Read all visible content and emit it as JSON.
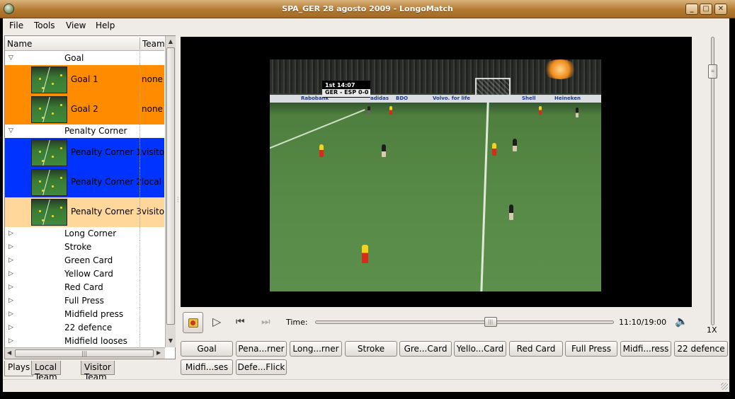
{
  "window": {
    "title": "SPA_GER 28 agosto 2009 - LongoMatch",
    "minimize": "_",
    "maximize": "□",
    "close": "✕"
  },
  "menu": [
    "File",
    "Tools",
    "View",
    "Help"
  ],
  "tree": {
    "columns": {
      "name": "Name",
      "team": "Team"
    },
    "categories": [
      {
        "label": "Goal",
        "expanded": true,
        "plays": [
          {
            "label": "Goal 1",
            "team": "none",
            "highlight": "#ff8c00"
          },
          {
            "label": "Goal 2",
            "team": "none",
            "highlight": "#ff8c00"
          }
        ]
      },
      {
        "label": "Penalty Corner",
        "expanded": true,
        "plays": [
          {
            "label": "Penalty Corner 1",
            "team": "visitor",
            "highlight": "#0033ff"
          },
          {
            "label": "Penalty Corner 2",
            "team": "local",
            "highlight": "#0033ff"
          },
          {
            "label": "Penalty Corner 3",
            "team": "visitor",
            "highlight": "#ffd79a"
          }
        ]
      },
      {
        "label": "Long Corner",
        "expanded": false,
        "plays": []
      },
      {
        "label": "Stroke",
        "expanded": false,
        "plays": []
      },
      {
        "label": "Green Card",
        "expanded": false,
        "plays": []
      },
      {
        "label": "Yellow Card",
        "expanded": false,
        "plays": []
      },
      {
        "label": "Red Card",
        "expanded": false,
        "plays": []
      },
      {
        "label": "Full Press",
        "expanded": false,
        "plays": []
      },
      {
        "label": "Midfield press",
        "expanded": false,
        "plays": []
      },
      {
        "label": "22 defence",
        "expanded": false,
        "plays": []
      },
      {
        "label": "Midfield looses",
        "expanded": false,
        "plays": []
      }
    ]
  },
  "left_tabs": [
    "Plays",
    "Local Team",
    "Visitor Team"
  ],
  "player": {
    "time_label": "Time:",
    "time_value": "11:10/19:00",
    "position_fraction": 0.588,
    "speed_label": "1X",
    "speed_fraction": 0.1,
    "overlay": {
      "period_clock": "1st   14:07",
      "score": "GER - ESP  0-0"
    },
    "ads": [
      "Rabobank",
      "adidas",
      "BDO",
      "Volvo. for life",
      "Shell",
      "Heineken"
    ]
  },
  "category_buttons": [
    "Goal",
    "Pena...rner",
    "Long...rner",
    "Stroke",
    "Gre...Card",
    "Yello...Card",
    "Red Card",
    "Full Press",
    "Midfi...ress",
    "22 defence",
    "Midfi...ses",
    "Defe...Flick"
  ],
  "colors": {
    "accent_orange": "#ff8c00",
    "selection_blue": "#0033ff",
    "pale_orange": "#ffd79a",
    "window_bg": "#efebe7"
  },
  "icons": {
    "app": "longomatch-icon",
    "collapse": "▽",
    "expand": "▷",
    "play": "▷",
    "prev": "⏮",
    "next": "⏭",
    "volume": "🔈"
  }
}
